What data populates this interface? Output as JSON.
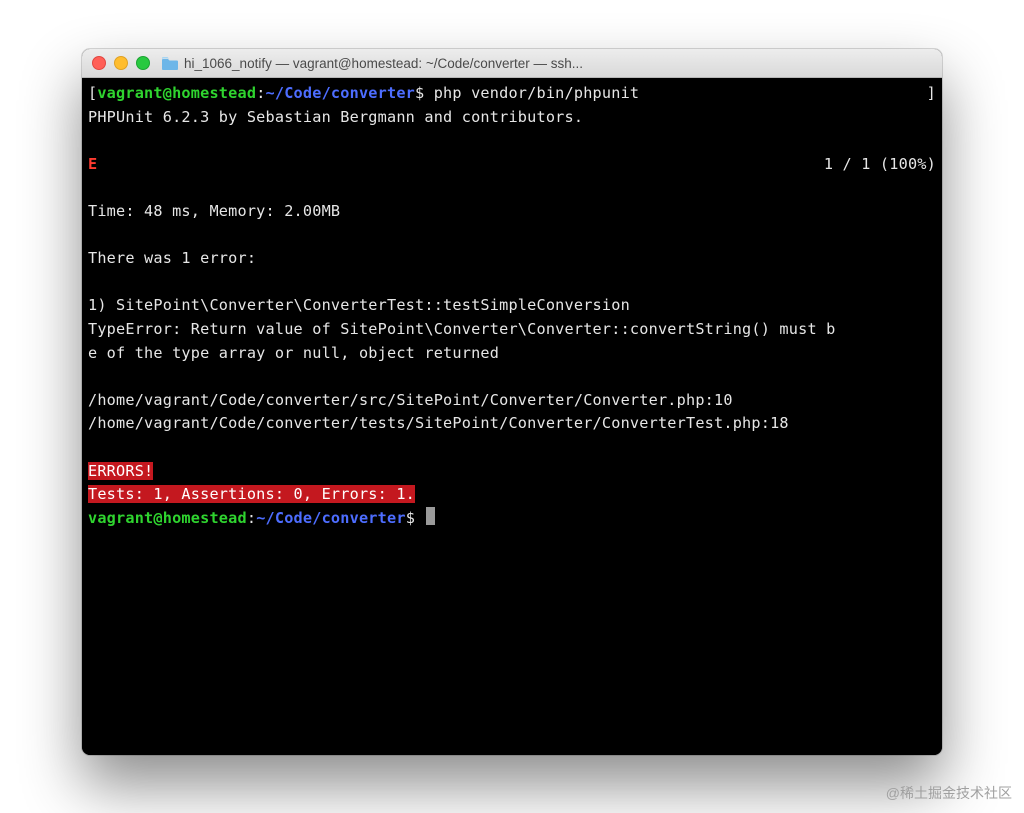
{
  "window": {
    "title": "hi_1066_notify — vagrant@homestead: ~/Code/converter — ssh..."
  },
  "prompt": {
    "bracket_open": "[",
    "bracket_close": "]",
    "user_host": "vagrant@homestead",
    "colon": ":",
    "path": "~/Code/converter",
    "dollar": "$"
  },
  "command": " php vendor/bin/phpunit",
  "output": {
    "banner": "PHPUnit 6.2.3 by Sebastian Bergmann and contributors.",
    "progress_letter": "E",
    "progress_count": "1 / 1 (100%)",
    "timing": "Time: 48 ms, Memory: 2.00MB",
    "error_intro": "There was 1 error:",
    "error_title": "1) SitePoint\\Converter\\ConverterTest::testSimpleConversion",
    "error_msg1": "TypeError: Return value of SitePoint\\Converter\\Converter::convertString() must b",
    "error_msg2": "e of the type array or null, object returned",
    "trace1": "/home/vagrant/Code/converter/src/SitePoint/Converter/Converter.php:10",
    "trace2": "/home/vagrant/Code/converter/tests/SitePoint/Converter/ConverterTest.php:18",
    "errors_header": "ERRORS!",
    "errors_summary": "Tests: 1, Assertions: 0, Errors: 1."
  },
  "watermark": "@稀土掘金技术社区"
}
